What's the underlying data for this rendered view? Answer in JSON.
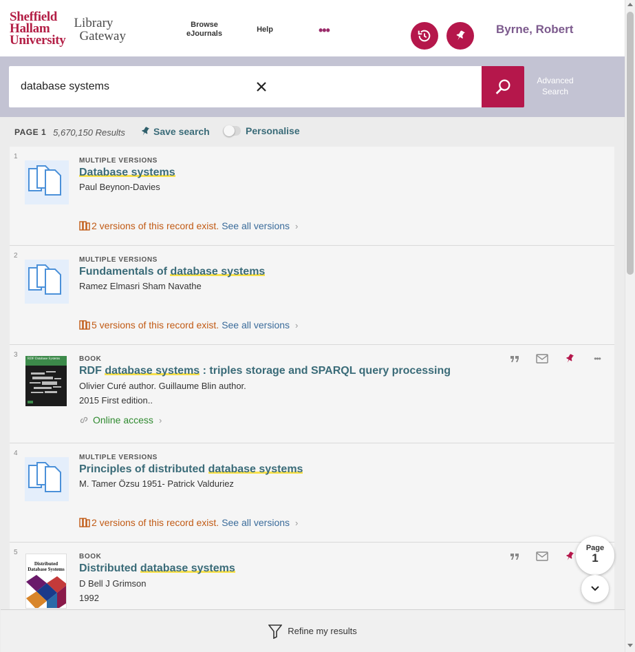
{
  "header": {
    "logo_line1": "Sheffield",
    "logo_line2": "Hallam",
    "logo_line3": "University",
    "logo_lg1": "Library",
    "logo_lg2": "Gateway",
    "nav_browse_line1": "Browse",
    "nav_browse_line2": "eJournals",
    "nav_help": "Help",
    "nav_more": "•••",
    "user_name": "Byrne, Robert"
  },
  "search": {
    "query": "database systems",
    "advanced_line1": "Advanced",
    "advanced_line2": "Search"
  },
  "results_bar": {
    "page_label": "PAGE 1",
    "count": "5,670,150 Results",
    "save_search": "Save search",
    "personalise": "Personalise"
  },
  "results": [
    {
      "index": "1",
      "type": "MULTIPLE VERSIONS",
      "title_pre": "",
      "title_hl": "Database systems",
      "title_post": "",
      "author": "Paul Beynon-Davies",
      "versions_text": "2 versions of this record exist.",
      "see_all": "See all versions"
    },
    {
      "index": "2",
      "type": "MULTIPLE VERSIONS",
      "title_pre": "Fundamentals of ",
      "title_hl": "database systems",
      "title_post": "",
      "author": "Ramez Elmasri Sham Navathe",
      "versions_text": "5 versions of this record exist.",
      "see_all": "See all versions"
    },
    {
      "index": "3",
      "type": "BOOK",
      "title_pre": "RDF ",
      "title_hl": "database systems",
      "title_post": " : triples storage and SPARQL query processing",
      "author": "Olivier Curé author. Guillaume Blin author.",
      "edition": "2015 First edition..",
      "online": "Online access",
      "cover_title": "RDF Database Systems"
    },
    {
      "index": "4",
      "type": "MULTIPLE VERSIONS",
      "title_pre": "Principles of distributed ",
      "title_hl": "database systems",
      "title_post": "",
      "author": "M. Tamer Özsu 1951- Patrick Valduriez",
      "versions_text": "2 versions of this record exist.",
      "see_all": "See all versions"
    },
    {
      "index": "5",
      "type": "BOOK",
      "title_pre": "Distributed ",
      "title_hl": "database systems",
      "title_post": "",
      "author": "D Bell J Grimson",
      "year": "1992",
      "cover_title": "Distributed Database Systems"
    }
  ],
  "page_indicator": {
    "label": "Page",
    "number": "1"
  },
  "refine": {
    "label": "Refine my results"
  },
  "colors": {
    "brand": "#b5174b",
    "link": "#3a6b78",
    "highlight": "#f7e04b",
    "versions": "#c15a14",
    "online": "#2f8a2f"
  },
  "icons": [
    "history-icon",
    "pin-icon",
    "search-icon",
    "close-icon",
    "versions-icon",
    "link-icon",
    "quote-icon",
    "email-icon",
    "more-icon",
    "chevron-down-icon",
    "filter-icon"
  ]
}
